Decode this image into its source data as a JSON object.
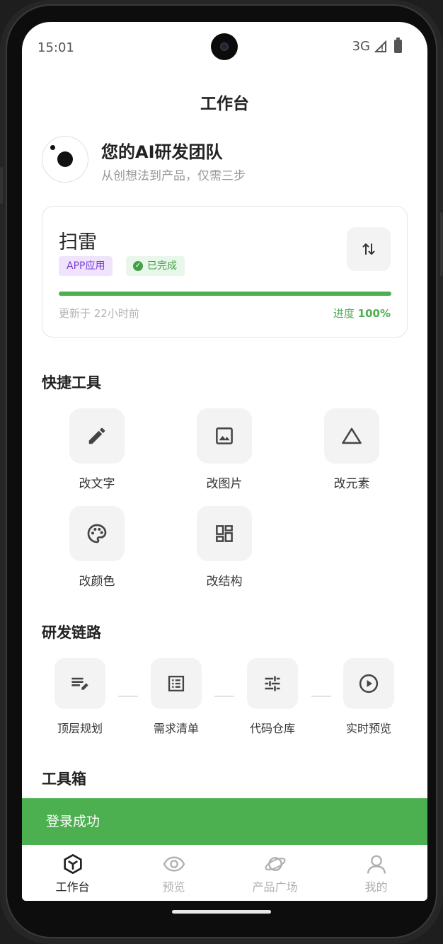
{
  "status_bar": {
    "time": "15:01",
    "network": "3G"
  },
  "page": {
    "title": "工作台"
  },
  "hero": {
    "title": "您的AI研发团队",
    "subtitle": "从创想法到产品，仅需三步"
  },
  "project": {
    "name": "扫雷",
    "type_tag": "APP应用",
    "status_tag": "已完成",
    "updated": "更新于 22小时前",
    "progress_label": "进度",
    "progress_value": "100%",
    "progress_fraction": 1.0
  },
  "quick_tools": {
    "title": "快捷工具",
    "items": [
      {
        "label": "改文字",
        "icon": "pencil-icon"
      },
      {
        "label": "改图片",
        "icon": "image-icon"
      },
      {
        "label": "改元素",
        "icon": "triangle-icon"
      },
      {
        "label": "改颜色",
        "icon": "palette-icon"
      },
      {
        "label": "改结构",
        "icon": "dashboard-icon"
      }
    ]
  },
  "pipeline": {
    "title": "研发链路",
    "steps": [
      {
        "label": "顶层规划",
        "icon": "edit-list-icon"
      },
      {
        "label": "需求清单",
        "icon": "list-alt-icon"
      },
      {
        "label": "代码仓库",
        "icon": "tune-icon"
      },
      {
        "label": "实时预览",
        "icon": "play-circle-icon"
      }
    ]
  },
  "toolbox": {
    "title": "工具箱"
  },
  "toast": {
    "message": "登录成功"
  },
  "bottom_nav": {
    "items": [
      {
        "label": "工作台",
        "icon": "cube-icon",
        "active": true
      },
      {
        "label": "预览",
        "icon": "eye-icon",
        "active": false
      },
      {
        "label": "产品广场",
        "icon": "planet-icon",
        "active": false
      },
      {
        "label": "我的",
        "icon": "user-icon",
        "active": false
      }
    ]
  },
  "colors": {
    "accent_green": "#4caf50",
    "tag_purple_bg": "#efe4fb",
    "tag_purple_text": "#7b3fd6",
    "tag_green_bg": "#e9f6ea"
  }
}
